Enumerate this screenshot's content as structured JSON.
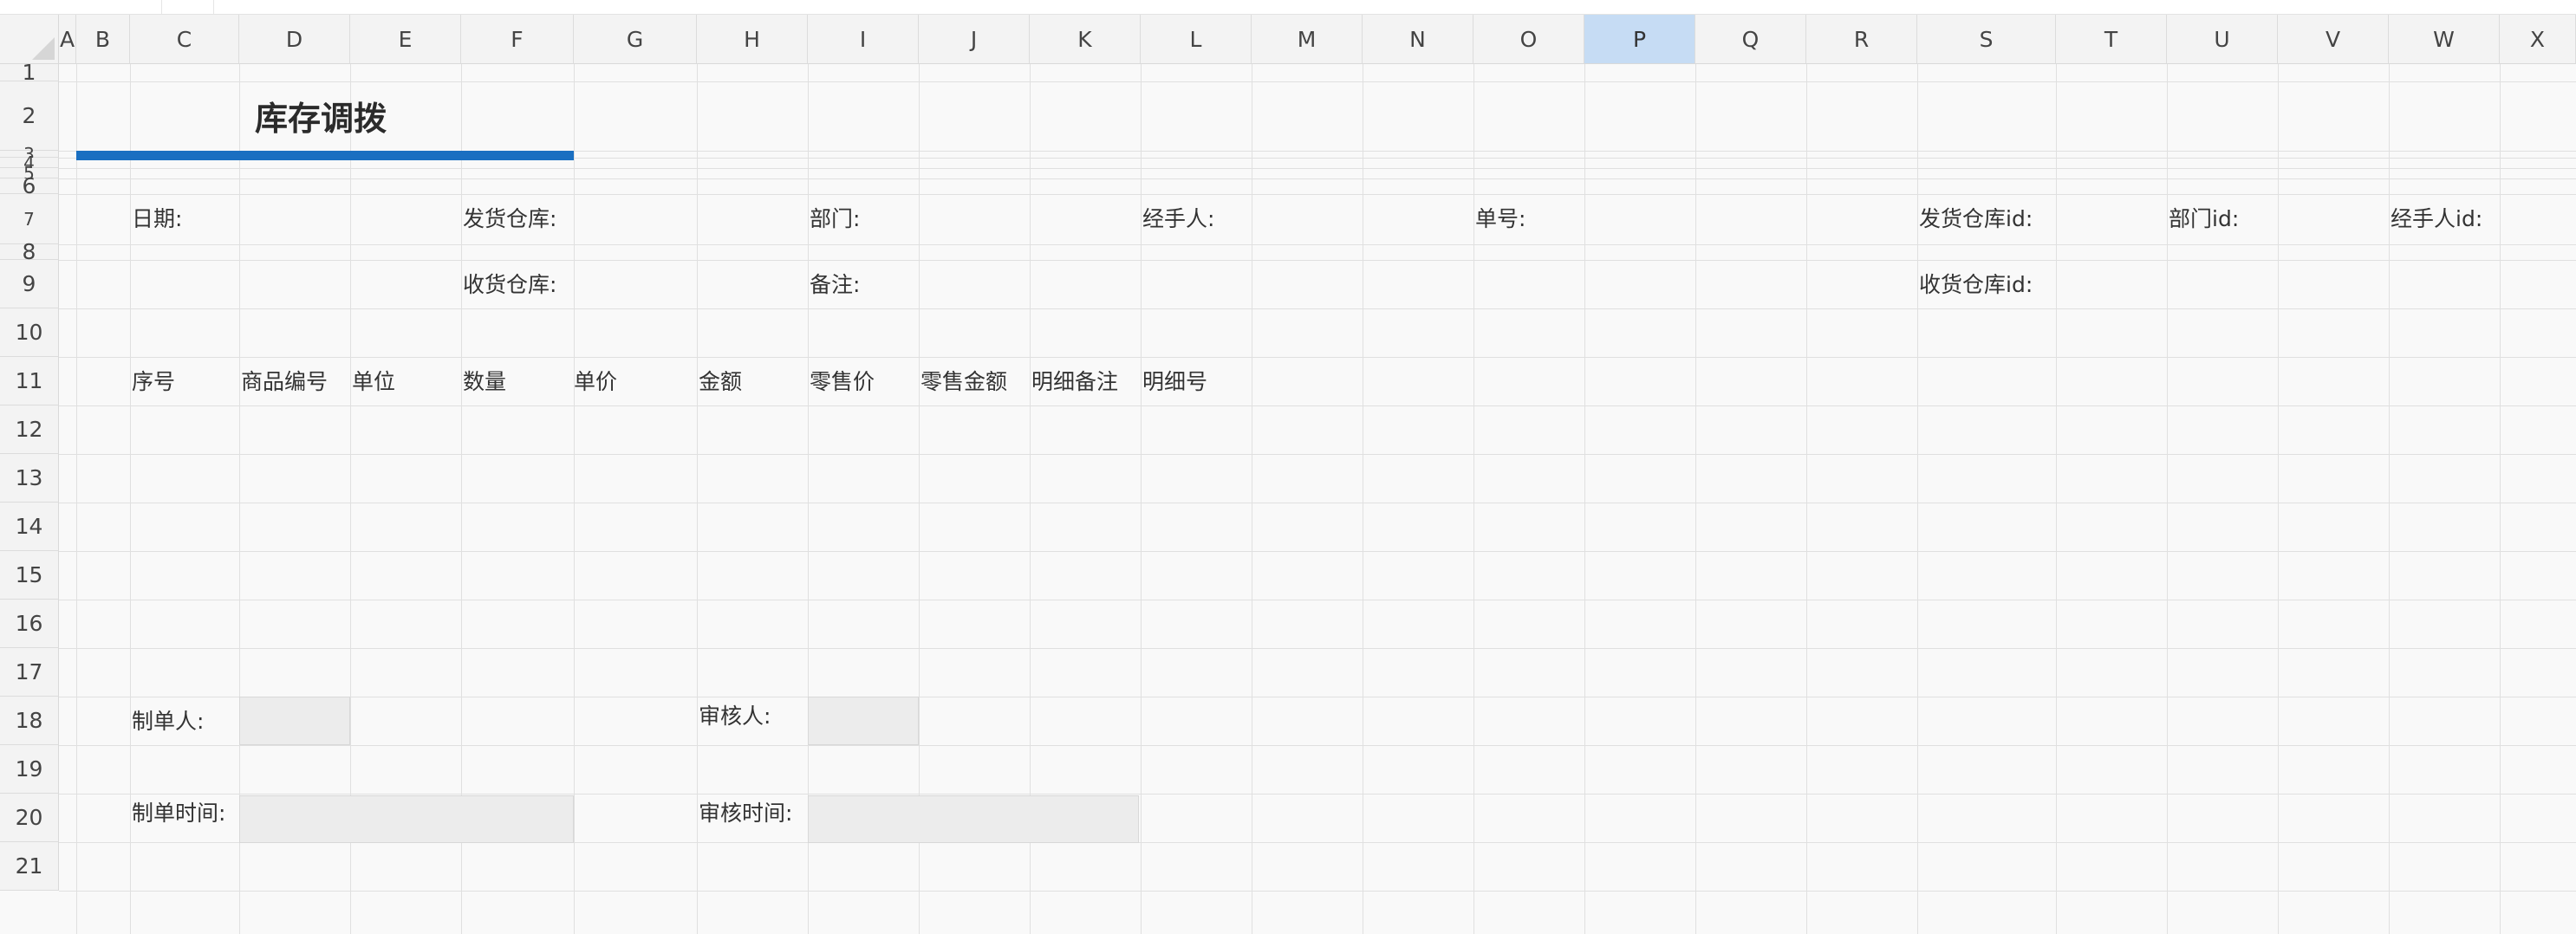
{
  "sheet": {
    "columns": [
      "A",
      "B",
      "C",
      "D",
      "E",
      "F",
      "G",
      "H",
      "I",
      "J",
      "K",
      "L",
      "M",
      "N",
      "O",
      "P",
      "Q",
      "R",
      "S",
      "T",
      "U",
      "V",
      "W",
      "X"
    ],
    "selected_column": "P",
    "rows": [
      "1",
      "2",
      "3",
      "4",
      "5",
      "6",
      "7",
      "8",
      "9",
      "10",
      "11",
      "12",
      "13",
      "14",
      "15",
      "16",
      "17",
      "18",
      "19",
      "20",
      "21"
    ]
  },
  "form": {
    "title": "库存调拨",
    "accent_color": "#1a6fc1",
    "header_fields": {
      "date_label": "日期:",
      "ship_warehouse_label": "发货仓库:",
      "department_label": "部门:",
      "handler_label": "经手人:",
      "order_no_label": "单号:",
      "ship_warehouse_id_label": "发货仓库id:",
      "department_id_label": "部门id:",
      "handler_id_label": "经手人id:",
      "receive_warehouse_label": "收货仓库:",
      "remark_label": "备注:",
      "receive_warehouse_id_label": "收货仓库id:"
    },
    "detail_headers": [
      "序号",
      "商品编号",
      "单位",
      "数量",
      "单价",
      "金额",
      "零售价",
      "零售金额",
      "明细备注",
      "明细号"
    ],
    "footer_fields": {
      "maker_label": "制单人:",
      "reviewer_label": "审核人:",
      "make_time_label": "制单时间:",
      "review_time_label": "审核时间:"
    }
  }
}
